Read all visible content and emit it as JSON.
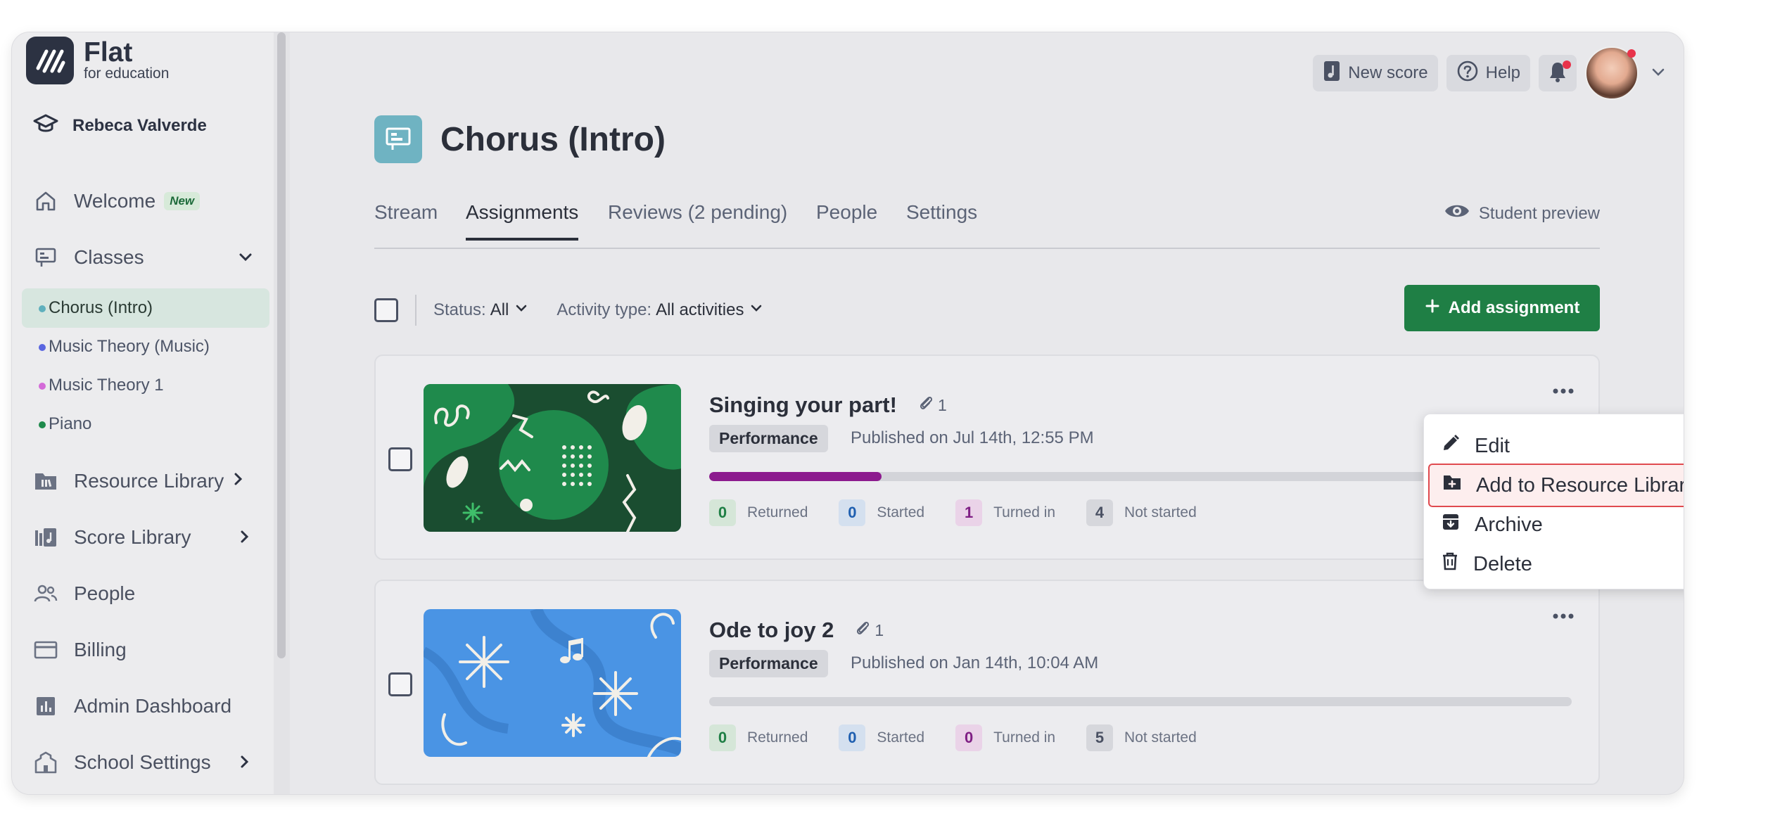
{
  "app": {
    "name": "Flat",
    "subtitle": "for education"
  },
  "user": {
    "name": "Rebeca Valverde"
  },
  "sidebar": {
    "nav": [
      {
        "label": "Welcome",
        "badge": "New"
      },
      {
        "label": "Classes"
      },
      {
        "label": "Resource Library"
      },
      {
        "label": "Score Library"
      },
      {
        "label": "People"
      },
      {
        "label": "Billing"
      },
      {
        "label": "Admin Dashboard"
      },
      {
        "label": "School Settings"
      }
    ],
    "classes": [
      {
        "label": "Chorus (Intro)",
        "color": "#5fb0bd"
      },
      {
        "label": "Music Theory (Music)",
        "color": "#5a66e0"
      },
      {
        "label": "Music Theory 1",
        "color": "#d46bd8"
      },
      {
        "label": "Piano",
        "color": "#1f8a4c"
      }
    ]
  },
  "topbar": {
    "new_score": "New score",
    "help": "Help"
  },
  "class": {
    "title": "Chorus (Intro)"
  },
  "tabs": [
    {
      "label": "Stream"
    },
    {
      "label": "Assignments"
    },
    {
      "label": "Reviews (2 pending)"
    },
    {
      "label": "People"
    },
    {
      "label": "Settings"
    }
  ],
  "student_preview": "Student preview",
  "filters": {
    "status_label": "Status:",
    "status_value": "All",
    "activity_label": "Activity type:",
    "activity_value": "All activities"
  },
  "add_assignment": "Add assignment",
  "stat_labels": {
    "returned": "Returned",
    "started": "Started",
    "turned_in": "Turned in",
    "not_started": "Not started"
  },
  "assignments": [
    {
      "title": "Singing your part!",
      "attachments": "1",
      "tag": "Performance",
      "published": "Published on Jul 14th, 12:55 PM",
      "progress": 0.2,
      "returned": "0",
      "started": "0",
      "turned_in": "1",
      "not_started": "4"
    },
    {
      "title": "Ode to joy 2",
      "attachments": "1",
      "tag": "Performance",
      "published": "Published on Jan 14th, 10:04 AM",
      "progress": 0,
      "returned": "0",
      "started": "0",
      "turned_in": "0",
      "not_started": "5"
    }
  ],
  "context_menu": [
    {
      "label": "Edit",
      "icon": "pencil-icon"
    },
    {
      "label": "Add to Resource Library",
      "icon": "folder-plus-icon"
    },
    {
      "label": "Archive",
      "icon": "archive-icon"
    },
    {
      "label": "Delete",
      "icon": "trash-icon"
    }
  ],
  "colors": {
    "accent": "#1f7f45",
    "progress": "#8c1b8e",
    "highlight_border": "#e04a4f"
  }
}
